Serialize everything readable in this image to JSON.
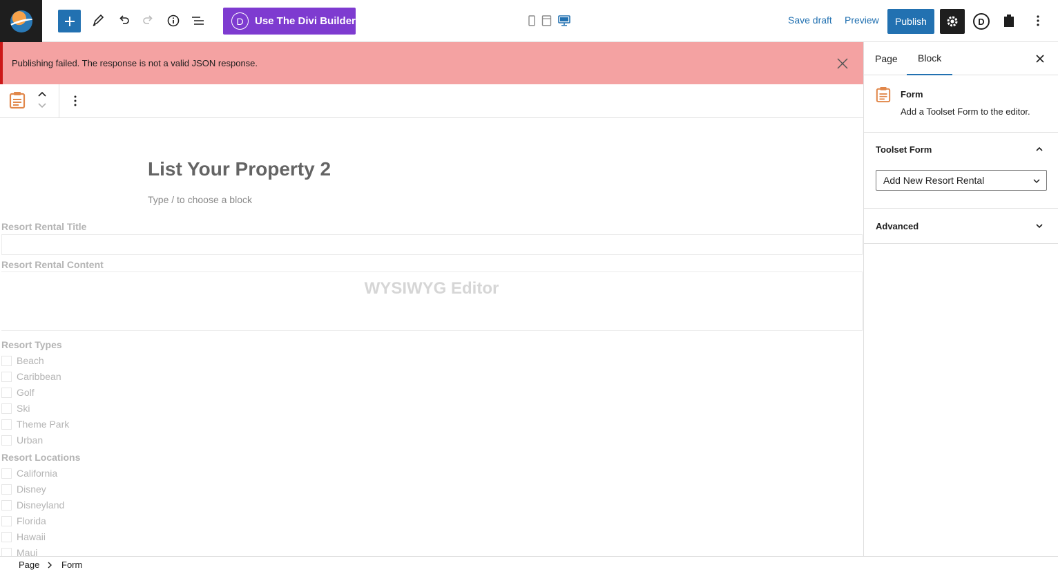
{
  "toolbar": {
    "divi_builder_label": "Use The Divi Builder",
    "divi_letter": "D",
    "save_draft_label": "Save draft",
    "preview_label": "Preview",
    "publish_label": "Publish"
  },
  "notice": {
    "message": "Publishing failed. The response is not a valid JSON response."
  },
  "editor": {
    "title": "List Your Property 2",
    "block_placeholder": "Type / to choose a block",
    "form": {
      "title_label": "Resort Rental Title",
      "content_label": "Resort Rental Content",
      "wysiwyg_label": "WYSIWYG Editor",
      "types_label": "Resort Types",
      "types": [
        "Beach",
        "Caribbean",
        "Golf",
        "Ski",
        "Theme Park",
        "Urban"
      ],
      "locations_label": "Resort Locations",
      "locations": [
        "California",
        "Disney",
        "Disneyland",
        "Florida",
        "Hawaii",
        "Maui"
      ]
    }
  },
  "sidebar": {
    "tabs": [
      {
        "label": "Page",
        "active": false
      },
      {
        "label": "Block",
        "active": true
      }
    ],
    "block": {
      "name": "Form",
      "description": "Add a Toolset Form to the editor."
    },
    "toolset_form": {
      "title": "Toolset Form",
      "selected": "Add New Resort Rental"
    },
    "advanced": {
      "title": "Advanced"
    }
  },
  "breadcrumb": [
    "Page",
    "Form"
  ],
  "colors": {
    "accent": "#2271b1",
    "divi_purple": "#7e3bd0",
    "error_bg": "#f4a2a2",
    "form_icon": "#e1874a"
  }
}
